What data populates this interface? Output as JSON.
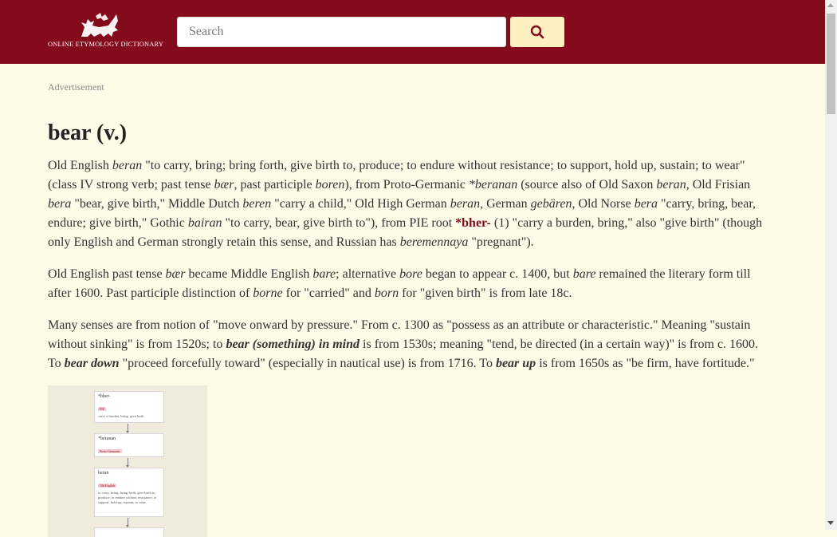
{
  "header": {
    "logo_text": "ONLINE ETYMOLOGY DICTIONARY",
    "search_placeholder": "Search",
    "search_icon": "search-icon",
    "brand_color": "#830b1b",
    "button_color": "#fcf0c0"
  },
  "ad_label": "Advertisement",
  "entry": {
    "title": "bear (v.)",
    "p1": [
      {
        "t": "Old English "
      },
      {
        "i": "beran"
      },
      {
        "t": " \"to carry, bring; bring forth, give birth to, produce; to endure without resistance; to support, hold up, sustain; to wear\" (class IV strong verb; past tense "
      },
      {
        "i": "bær"
      },
      {
        "t": ", past participle "
      },
      {
        "i": "boren"
      },
      {
        "t": "), from Proto-Germanic "
      },
      {
        "i": "*beranan"
      },
      {
        "t": " (source also of Old Saxon "
      },
      {
        "i": "beran"
      },
      {
        "t": ", Old Frisian "
      },
      {
        "i": "bera"
      },
      {
        "t": " \"bear, give birth,\" Middle Dutch "
      },
      {
        "i": "beren"
      },
      {
        "t": " \"carry a child,\" Old High German "
      },
      {
        "i": "beran"
      },
      {
        "t": ", German "
      },
      {
        "i": "gebären"
      },
      {
        "t": ", Old Norse "
      },
      {
        "i": "bera"
      },
      {
        "t": " \"carry, bring, bear, endure; give birth,\" Gothic "
      },
      {
        "i": "bairan"
      },
      {
        "t": " \"to carry, bear, give birth to\"), from PIE root "
      },
      {
        "x": "*bher-"
      },
      {
        "t": " (1) \"carry a burden, bring,\" also \"give birth\" (though only English and German strongly retain this sense, and Russian has "
      },
      {
        "i": "beremennaya"
      },
      {
        "t": " \"pregnant\")."
      }
    ],
    "p2": [
      {
        "t": "Old English past tense "
      },
      {
        "i": "bær"
      },
      {
        "t": " became Middle English "
      },
      {
        "i": "bare"
      },
      {
        "t": "; alternative "
      },
      {
        "i": "bore"
      },
      {
        "t": " began to appear c. 1400, but "
      },
      {
        "i": "bare"
      },
      {
        "t": " remained the literary form till after 1600. Past participle distinction of "
      },
      {
        "i": "borne"
      },
      {
        "t": " for \"carried\" and "
      },
      {
        "i": "born"
      },
      {
        "t": " for \"given birth\" is from late 18c."
      }
    ],
    "p3": [
      {
        "t": "Many senses are from notion of \"move onward by pressure.\" From c. 1300 as \"possess as an attribute or characteristic.\" Meaning \"sustain without sinking\" is from 1520s; to "
      },
      {
        "b": "bear (something) in mind"
      },
      {
        "t": " is from 1530s; meaning \"tend, be directed (in a certain way)\" is from c. 1600. To "
      },
      {
        "b": "bear down"
      },
      {
        "t": " \"proceed forcefully toward\" (especially in nautical use) is from 1716. To "
      },
      {
        "b": "bear up"
      },
      {
        "t": " is from 1650s as \"be firm, have fortitude.\""
      }
    ]
  },
  "diagram": {
    "nodes": [
      {
        "head": "*bher-",
        "tag": "PIE",
        "gloss": "carry a burden, bring; give birth"
      },
      {
        "head": "*beranan",
        "tag": "Proto-Germanic",
        "gloss": ""
      },
      {
        "head": "beran",
        "tag": "Old English",
        "gloss": "to carry, bring; bring forth, give birth to, produce; to endure without resistance; to support, hold up, sustain; to wear"
      }
    ]
  }
}
